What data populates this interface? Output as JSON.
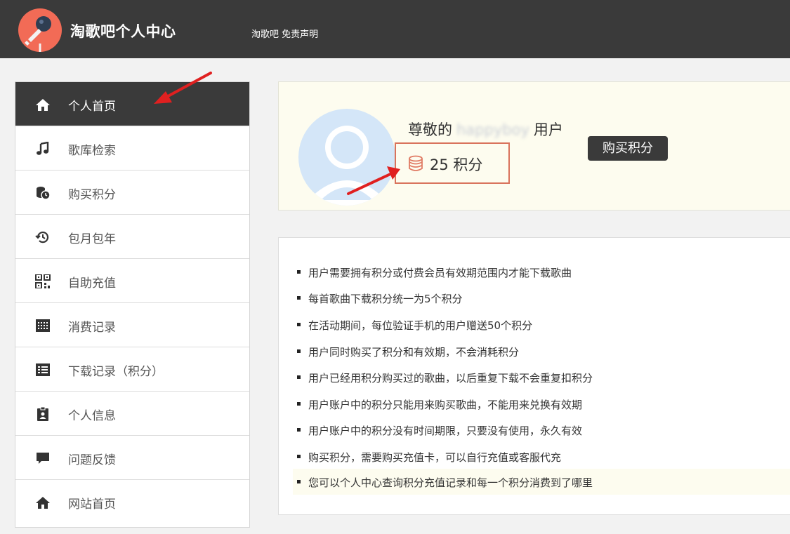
{
  "header": {
    "site_title": "淘歌吧个人中心",
    "link_home": "淘歌吧",
    "link_disclaimer": "免责声明"
  },
  "sidebar": {
    "items": [
      {
        "label": "个人首页",
        "icon": "home-icon",
        "active": true
      },
      {
        "label": "歌库检索",
        "icon": "music-note-icon"
      },
      {
        "label": "购买积分",
        "icon": "coins-icon"
      },
      {
        "label": "包月包年",
        "icon": "history-icon"
      },
      {
        "label": "自助充值",
        "icon": "qrcode-icon"
      },
      {
        "label": "消费记录",
        "icon": "calendar-icon"
      },
      {
        "label": "下载记录（积分）",
        "icon": "list-icon"
      },
      {
        "label": "个人信息",
        "icon": "id-badge-icon"
      },
      {
        "label": "问题反馈",
        "icon": "comment-icon"
      },
      {
        "label": "网站首页",
        "icon": "home-icon"
      }
    ]
  },
  "profile": {
    "greeting_prefix": "尊敬的",
    "username": "happyboy",
    "greeting_suffix": "用户",
    "points": "25 积分",
    "buy_button": "购买积分"
  },
  "rules": [
    "用户需要拥有积分或付费会员有效期范围内才能下载歌曲",
    "每首歌曲下载积分统一为5个积分",
    "在活动期间，每位验证手机的用户赠送50个积分",
    "用户同时购买了积分和有效期，不会消耗积分",
    "用户已经用积分购买过的歌曲，以后重复下载不会重复扣积分",
    "用户账户中的积分只能用来购买歌曲，不能用来兑换有效期",
    "用户账户中的积分没有时间期限，只要没有使用，永久有效",
    "购买积分，需要购买充值卡，可以自行充值或客服代充",
    "您可以个人中心查询积分充值记录和每一个积分消费到了哪里"
  ],
  "colors": {
    "header_bg": "#3a3a3a",
    "logo_bg": "#f26b56",
    "card_bg": "#fdfcef",
    "points_border": "#d9735c",
    "annotation_red": "#e02020"
  }
}
